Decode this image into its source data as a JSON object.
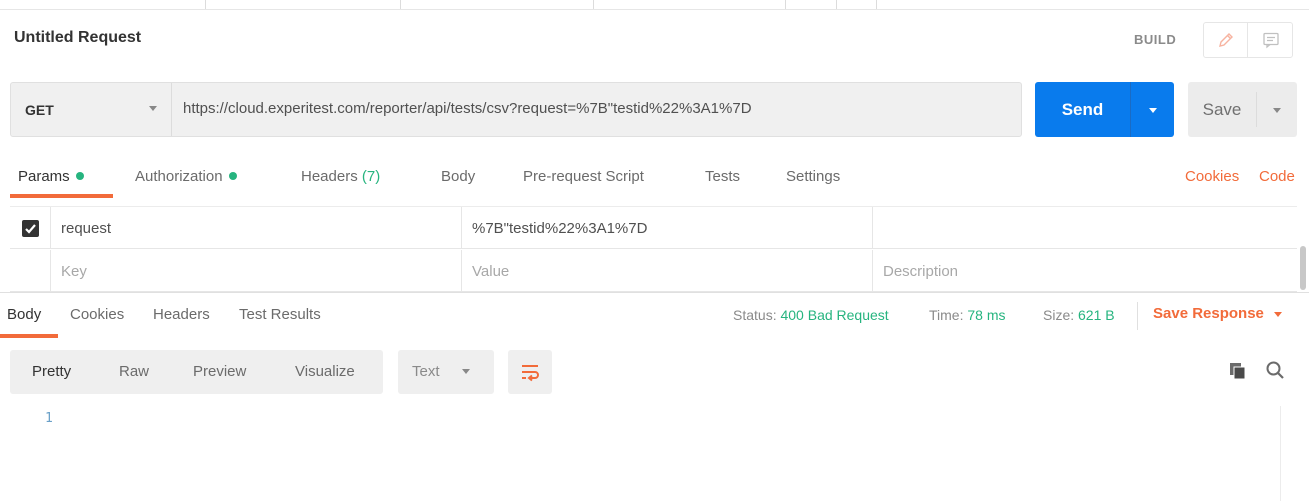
{
  "request": {
    "title": "Untitled Request",
    "mode_label": "BUILD",
    "method": "GET",
    "url": "https://cloud.experitest.com/reporter/api/tests/csv?request=%7B\"testid%22%3A1%7D",
    "send_label": "Send",
    "save_label": "Save"
  },
  "request_tabs": {
    "params": "Params",
    "authorization": "Authorization",
    "headers": "Headers",
    "headers_count": "(7)",
    "body": "Body",
    "pre_request": "Pre-request Script",
    "tests": "Tests",
    "settings": "Settings",
    "cookies": "Cookies",
    "code": "Code"
  },
  "params": {
    "rows": [
      {
        "checked": true,
        "key": "request",
        "value": "%7B\"testid%22%3A1%7D",
        "description": ""
      }
    ],
    "placeholder": {
      "key": "Key",
      "value": "Value",
      "description": "Description"
    }
  },
  "response_tabs": {
    "body": "Body",
    "cookies": "Cookies",
    "headers": "Headers",
    "test_results": "Test Results"
  },
  "response_meta": {
    "status_label": "Status:",
    "status_value": "400 Bad Request",
    "time_label": "Time:",
    "time_value": "78 ms",
    "size_label": "Size:",
    "size_value": "621 B",
    "save_response": "Save Response"
  },
  "view_modes": [
    "Pretty",
    "Raw",
    "Preview",
    "Visualize"
  ],
  "format": "Text",
  "editor": {
    "line_numbers": [
      "1"
    ]
  },
  "colors": {
    "accent_orange": "#f26b3a",
    "send_blue": "#097bed",
    "success_green": "#26b47f"
  },
  "icons": [
    "pencil-icon",
    "comment-icon",
    "chevron-down-icon",
    "check-icon",
    "wrap-lines-icon",
    "copy-icon",
    "search-icon"
  ]
}
